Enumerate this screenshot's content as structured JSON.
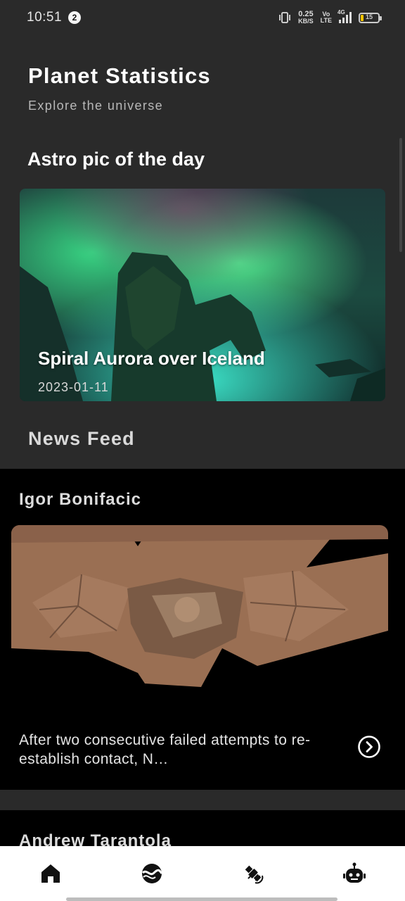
{
  "status_bar": {
    "time": "10:51",
    "notification_count": "2",
    "net_speed_value": "0.25",
    "net_speed_unit": "KB/S",
    "volte_top": "Vo",
    "volte_bottom": "LTE",
    "network_type": "4G",
    "battery_level": "15"
  },
  "header": {
    "title": "Planet Statistics",
    "subtitle": "Explore the universe"
  },
  "apod": {
    "section_title": "Astro pic of the day",
    "title": "Spiral Aurora over Iceland",
    "date": "2023-01-11"
  },
  "news": {
    "section_title": "News Feed",
    "items": [
      {
        "author": "Igor Bonifacic",
        "summary": "After two consecutive failed attempts to re-establish contact, N…"
      },
      {
        "author": "Andrew Tarantola"
      }
    ]
  },
  "bottom_nav": {
    "items": [
      {
        "icon": "home-icon"
      },
      {
        "icon": "planet-icon"
      },
      {
        "icon": "satellite-icon"
      },
      {
        "icon": "robot-icon"
      }
    ]
  },
  "colors": {
    "background": "#2a2a2a",
    "card_background": "#000000",
    "nav_background": "#ffffff",
    "accent_text": "#ffffff"
  }
}
